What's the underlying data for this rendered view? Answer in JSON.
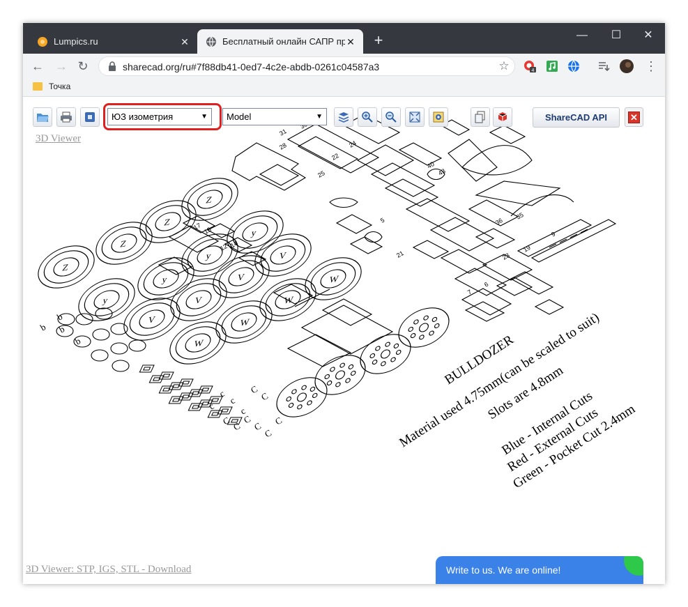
{
  "browser": {
    "tabs": [
      {
        "title": "Lumpics.ru",
        "active": false
      },
      {
        "title": "Бесплатный онлайн САПР прос",
        "active": true
      }
    ],
    "address": "sharecad.org/ru#7f88db41-0ed7-4c2e-abdb-0261c04587a3",
    "bookmarks": [
      {
        "label": "Точка"
      }
    ],
    "extension_badge": "4"
  },
  "toolbar": {
    "view_select": "ЮЗ изометрия",
    "layout_select": "Model",
    "api_button": "ShareCAD API",
    "close_label": "✕"
  },
  "links": {
    "viewer": "3D Viewer",
    "download": "3D Viewer: STP, IGS, STL - Download"
  },
  "drawing": {
    "title": "BULLDOZER",
    "notes": [
      "Material used 4.75mm(can be scaled to suit)",
      "Slots are 4.8mm"
    ],
    "legend": [
      "Blue - Internal Cuts",
      "Red - External Cuts",
      "Green - Pocket Cut 2.4mm"
    ],
    "wheel_letters": [
      "Z",
      "Z",
      "Z",
      "Z",
      "y",
      "y",
      "y",
      "y",
      "V",
      "V",
      "V",
      "V",
      "W",
      "W",
      "W",
      "W"
    ],
    "part_numbers": [
      "31",
      "30",
      "28",
      "25",
      "22",
      "24",
      "40",
      "43",
      "17",
      "15",
      "12",
      "14",
      "36",
      "35",
      "23",
      "19",
      "21",
      "5",
      "7",
      "6",
      "9"
    ],
    "small_letters": [
      "b",
      "b",
      "b",
      "b",
      "c",
      "c",
      "c",
      "c",
      "C",
      "C",
      "C",
      "C",
      "C",
      "C",
      "C",
      "C"
    ]
  },
  "chat": {
    "text": "Write to us. We are online!"
  },
  "colors": {
    "accent_red": "#e02020",
    "chat_blue": "#3b82e8",
    "chat_green": "#2ec84a",
    "api_text": "#1e3c72"
  }
}
